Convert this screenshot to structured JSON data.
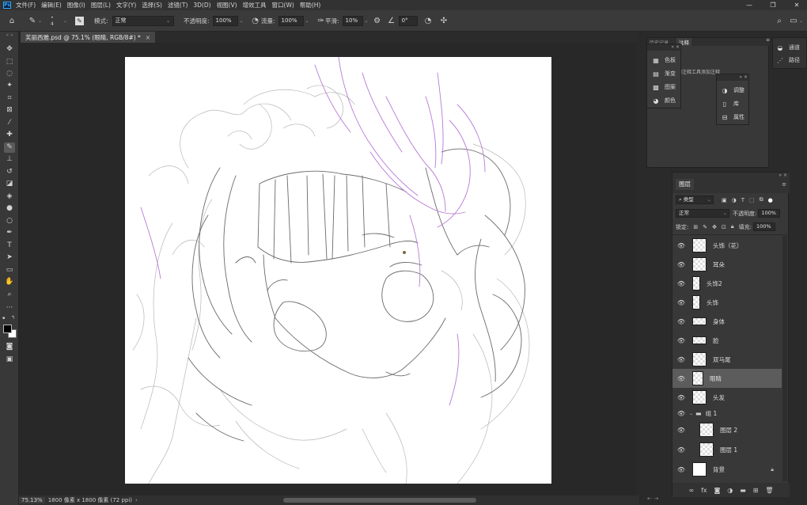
{
  "app": {
    "logo": "Ps"
  },
  "menu": [
    "文件(F)",
    "编辑(E)",
    "图像(I)",
    "图层(L)",
    "文字(Y)",
    "选择(S)",
    "滤镜(T)",
    "3D(D)",
    "视图(V)",
    "增效工具",
    "窗口(W)",
    "帮助(H)"
  ],
  "window_controls": {
    "minimize": "—",
    "restore": "❐",
    "close": "✕"
  },
  "options": {
    "brush_size": "4",
    "mode_label": "模式:",
    "mode_value": "正常",
    "opacity_label": "不透明度:",
    "opacity_value": "100%",
    "flow_label": "流量:",
    "flow_value": "100%",
    "smoothing_label": "平滑:",
    "smoothing_value": "10%",
    "angle_value": "0°"
  },
  "document": {
    "tab_title": "芙丽西雅.psd @ 75.1% (眼睛, RGB/8#) *",
    "close": "×"
  },
  "status": {
    "zoom": "75.13%",
    "info": "1800 像素 x 1800 像素 (72 ppi)",
    "arrow": "›"
  },
  "panels": {
    "history_tab": "历史记录",
    "notes_tab": "注释",
    "notes_hint": "使用注释工具添加注释",
    "group_a": [
      {
        "icon": "swatches-icon",
        "label": "色板"
      },
      {
        "icon": "gradient-icon",
        "label": "渐变"
      },
      {
        "icon": "pattern-icon",
        "label": "图案"
      },
      {
        "icon": "color-icon",
        "label": "颜色"
      }
    ],
    "group_b": [
      {
        "icon": "adjustments-icon",
        "label": "调整"
      },
      {
        "icon": "libraries-icon",
        "label": "库"
      },
      {
        "icon": "properties-icon",
        "label": "属性"
      }
    ],
    "group_c": [
      {
        "icon": "channels-icon",
        "label": "通道"
      },
      {
        "icon": "paths-icon",
        "label": "路径"
      }
    ]
  },
  "layers": {
    "tab": "图层",
    "filter_kind": "类型",
    "blend_mode": "正常",
    "opacity_label": "不透明度:",
    "opacity_value": "100%",
    "lock_label": "锁定:",
    "fill_label": "填充:",
    "fill_value": "100%",
    "items": [
      {
        "name": "头饰（花）",
        "visible": true,
        "selected": false
      },
      {
        "name": "耳朵",
        "visible": true,
        "selected": false
      },
      {
        "name": "头饰2",
        "visible": true,
        "selected": false
      },
      {
        "name": "头饰",
        "visible": true,
        "selected": false
      },
      {
        "name": "身体",
        "visible": true,
        "selected": false
      },
      {
        "name": "脸",
        "visible": true,
        "selected": false
      },
      {
        "name": "双马尾",
        "visible": true,
        "selected": false
      },
      {
        "name": "眼睛",
        "visible": true,
        "selected": true
      },
      {
        "name": "头发",
        "visible": true,
        "selected": false
      },
      {
        "name": "组 1",
        "visible": true,
        "selected": false,
        "group": true
      },
      {
        "name": "图层 2",
        "visible": true,
        "selected": false,
        "indent": true
      },
      {
        "name": "图层 1",
        "visible": true,
        "selected": false,
        "indent": true
      },
      {
        "name": "背景",
        "visible": true,
        "selected": false,
        "locked": true
      }
    ]
  },
  "colors": {
    "accent": "#31a8ff",
    "sketch_gray": "#8a8a8a",
    "sketch_purple": "#b77ad6",
    "sketch_dark": "#555555",
    "panel_bg": "#383838"
  }
}
